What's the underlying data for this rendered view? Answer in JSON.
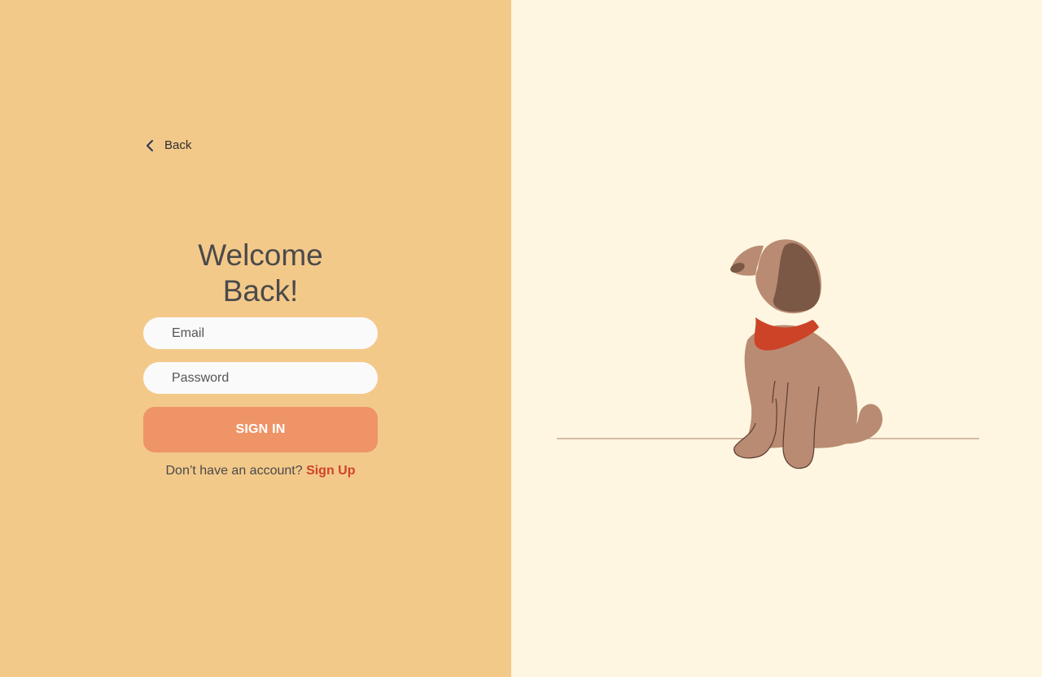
{
  "back": {
    "label": "Back"
  },
  "welcome": {
    "line1": "Welcome",
    "line2": "Back!"
  },
  "form": {
    "email_placeholder": "Email",
    "email_value": "",
    "password_placeholder": "Password",
    "password_value": "",
    "submit_label": "SIGN IN"
  },
  "signup": {
    "prompt": "Don’t have an account?",
    "link_label": "Sign Up"
  },
  "colors": {
    "left_background": "#f3c98a",
    "right_background": "#fef6e1",
    "button": "#ef9467",
    "accent_link": "#d0432a",
    "dog_body": "#b98b72",
    "dog_ear": "#7b5745",
    "dog_collar": "#cd4327"
  },
  "icons": {
    "back": "chevron-left-icon"
  },
  "illustration": {
    "subject": "dog-illustration"
  }
}
